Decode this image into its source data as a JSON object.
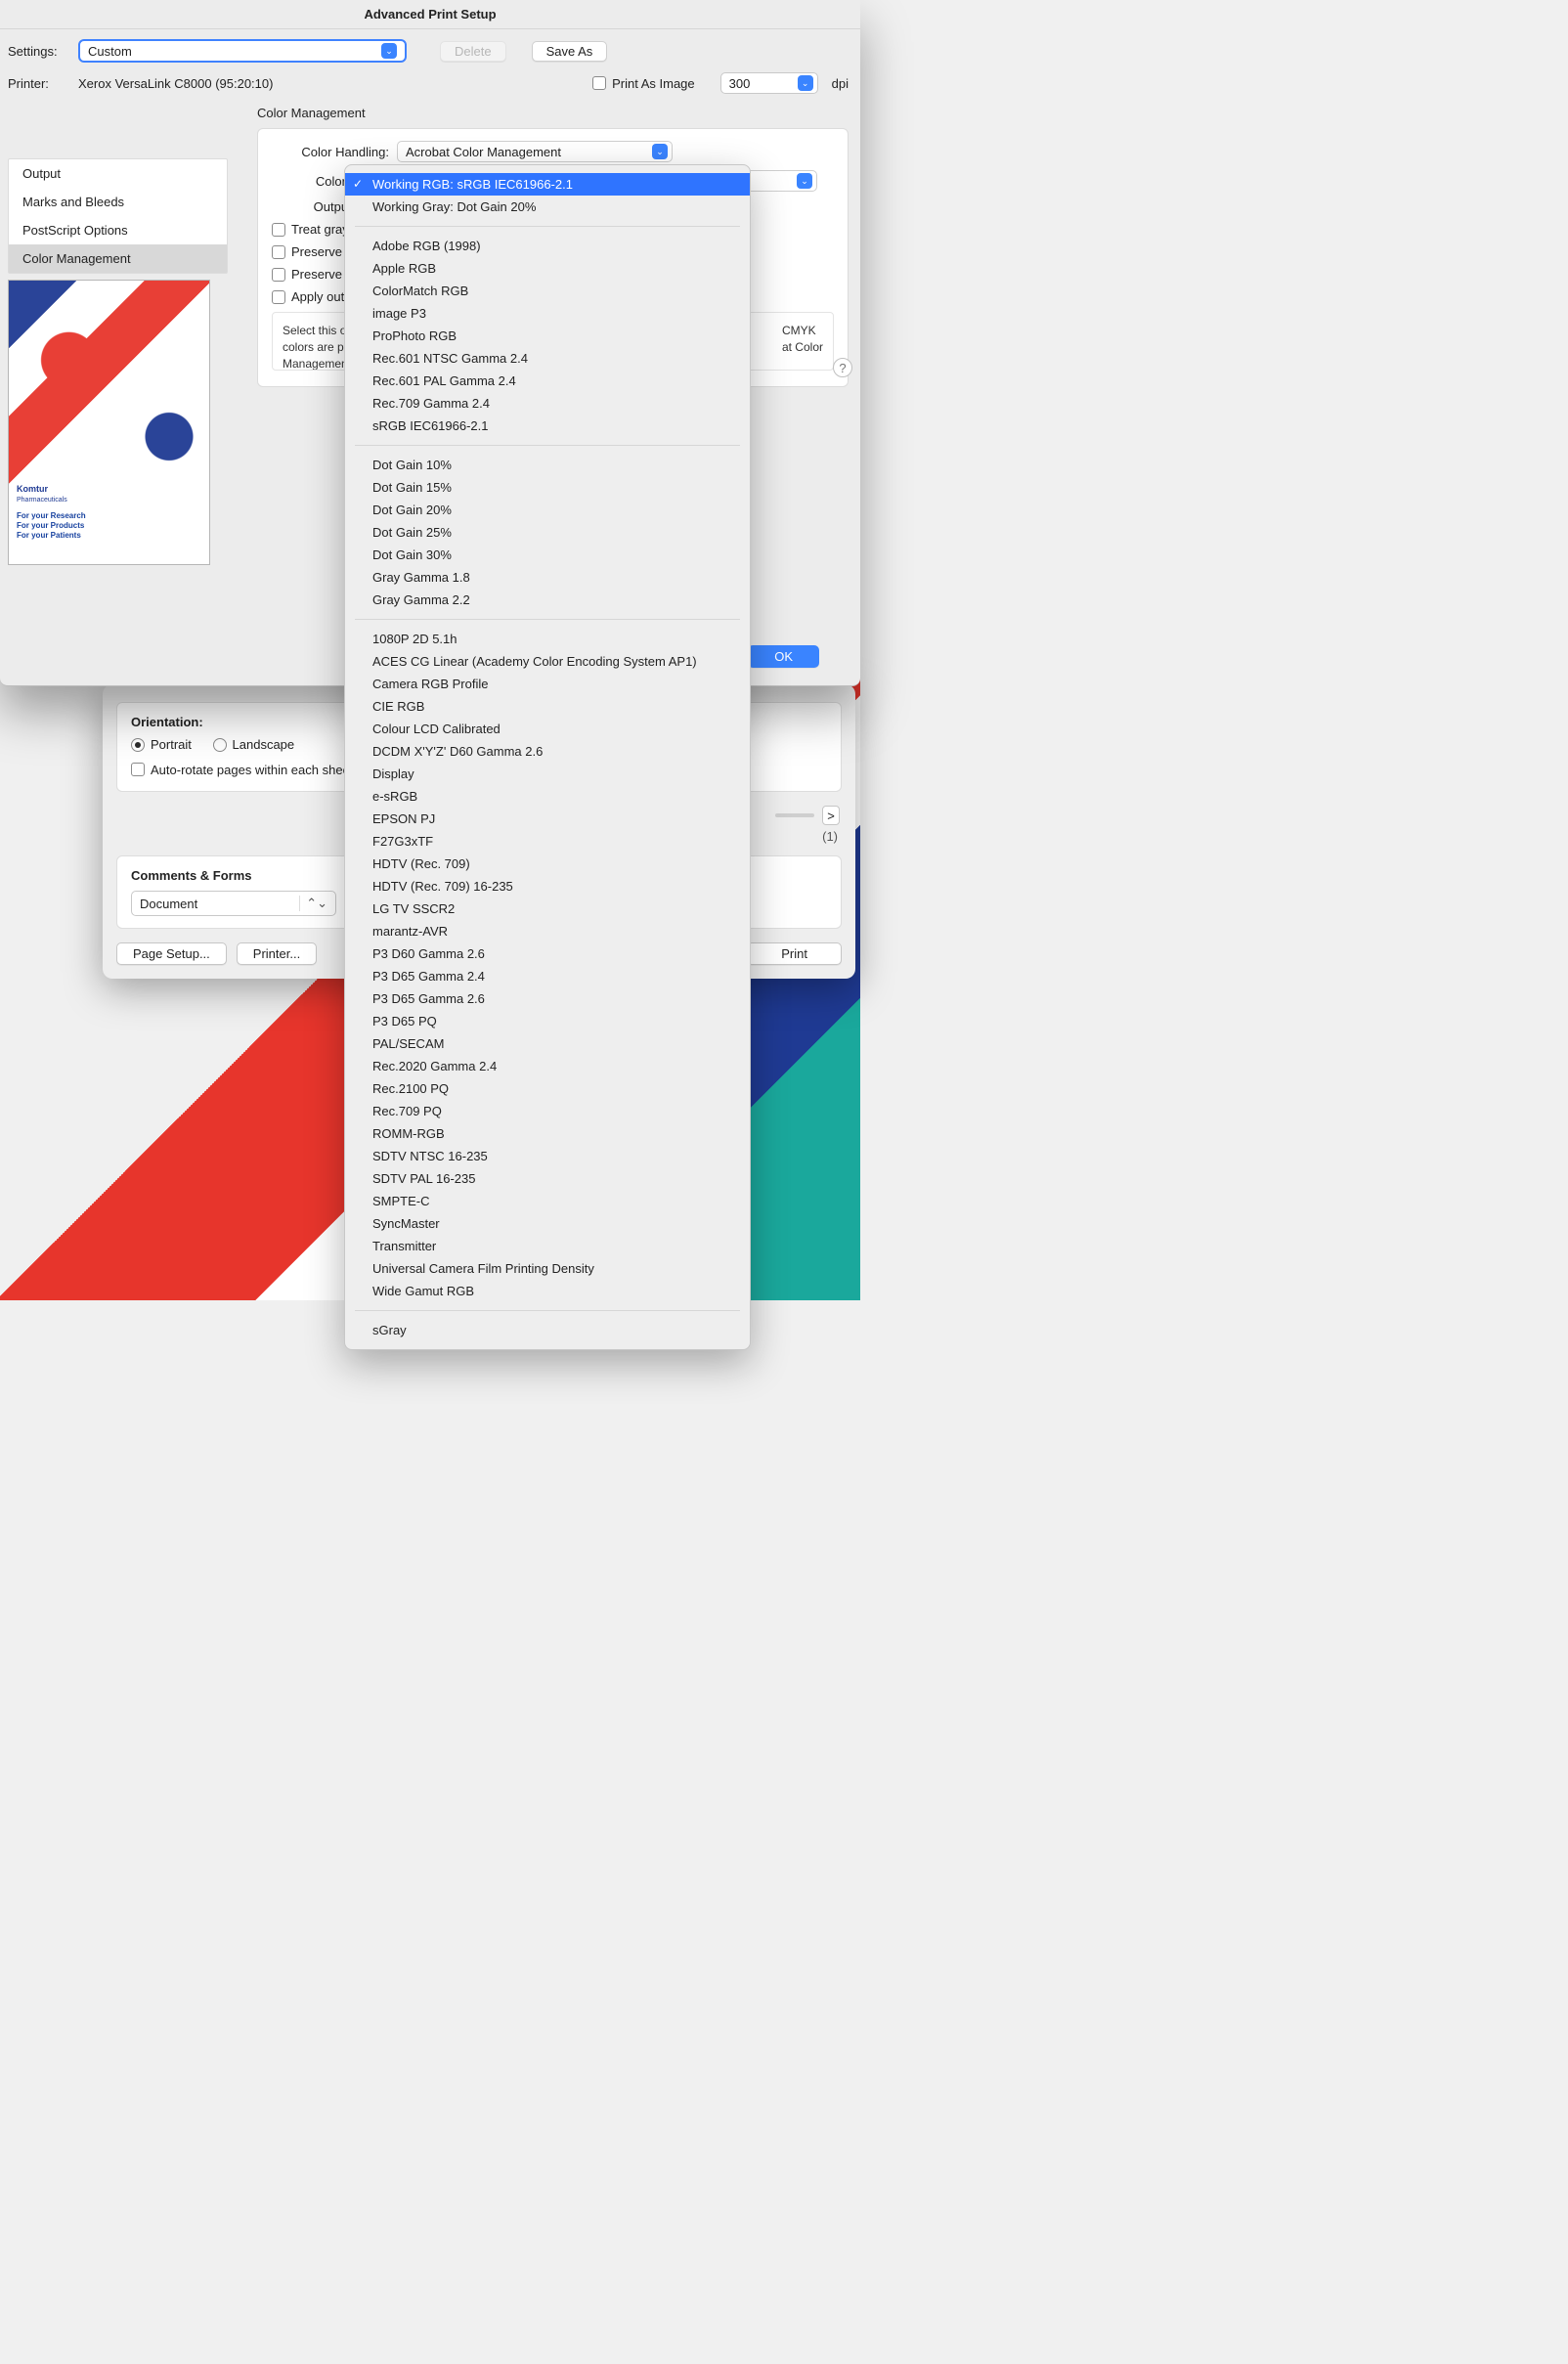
{
  "title": "Advanced Print Setup",
  "settings": {
    "label": "Settings:",
    "value": "Custom"
  },
  "buttons": {
    "delete": "Delete",
    "saveAs": "Save As",
    "ok": "OK",
    "pageSetup": "Page Setup...",
    "printer": "Printer...",
    "print": "Print"
  },
  "printer": {
    "label": "Printer:",
    "name": "Xerox VersaLink C8000 (95:20:10)"
  },
  "printAsImage": {
    "label": "Print As Image",
    "dpi": "300",
    "unit": "dpi"
  },
  "sidebar": [
    "Output",
    "Marks and Bleeds",
    "PostScript Options",
    "Color Management"
  ],
  "section": "Color Management",
  "cm": {
    "handlingLabel": "Color Handling:",
    "handlingValue": "Acrobat Color Management",
    "profileLabel": "Color Profile:",
    "outputLabel": "Output Color:",
    "treatGrays": "Treat grays as",
    "preserveBlack": "Preserve Black",
    "preserveCMYK": "Preserve CMY",
    "applyOutput": "Apply output p",
    "help": "Select this optio\ncolors are prese\nManagement an",
    "helpRight": "CMYK\nat Color"
  },
  "thumb": {
    "brand": "Komtur",
    "brandSub": "Pharmaceuticals",
    "l1": "For your Research",
    "l2": "For your Products",
    "l3": "For your Patients"
  },
  "behind": {
    "orientationLabel": "Orientation:",
    "portrait": "Portrait",
    "landscape": "Landscape",
    "autorotate": "Auto-rotate pages within each shee",
    "commentsLabel": "Comments & Forms",
    "commentsValue": "Document",
    "stepForward": ">",
    "pageInfo": "(1)"
  },
  "menu": {
    "group1": [
      "Working RGB: sRGB IEC61966-2.1",
      "Working Gray: Dot Gain 20%"
    ],
    "group2": [
      "Adobe RGB (1998)",
      "Apple RGB",
      "ColorMatch RGB",
      "image P3",
      "ProPhoto RGB",
      "Rec.601 NTSC Gamma 2.4",
      "Rec.601 PAL Gamma 2.4",
      "Rec.709 Gamma 2.4",
      "sRGB IEC61966-2.1"
    ],
    "group3": [
      "Dot Gain 10%",
      "Dot Gain 15%",
      "Dot Gain 20%",
      "Dot Gain 25%",
      "Dot Gain 30%",
      "Gray Gamma 1.8",
      "Gray Gamma 2.2"
    ],
    "group4": [
      "1080P 2D 5.1h",
      "ACES CG Linear (Academy Color Encoding System AP1)",
      "Camera RGB Profile",
      "CIE RGB",
      "Colour LCD Calibrated",
      "DCDM X'Y'Z' D60 Gamma 2.6",
      "Display",
      "e-sRGB",
      "EPSON PJ",
      "F27G3xTF",
      "HDTV (Rec. 709)",
      "HDTV (Rec. 709) 16-235",
      "LG TV SSCR2",
      "marantz-AVR",
      "P3 D60 Gamma 2.6",
      "P3 D65 Gamma 2.4",
      "P3 D65 Gamma 2.6",
      "P3 D65 PQ",
      "PAL/SECAM",
      "Rec.2020 Gamma 2.4",
      "Rec.2100 PQ",
      "Rec.709 PQ",
      "ROMM-RGB",
      "SDTV NTSC 16-235",
      "SDTV PAL 16-235",
      "SMPTE-C",
      "SyncMaster",
      "Transmitter",
      "Universal Camera Film Printing Density",
      "Wide Gamut RGB"
    ],
    "group5": [
      "sGray"
    ]
  }
}
